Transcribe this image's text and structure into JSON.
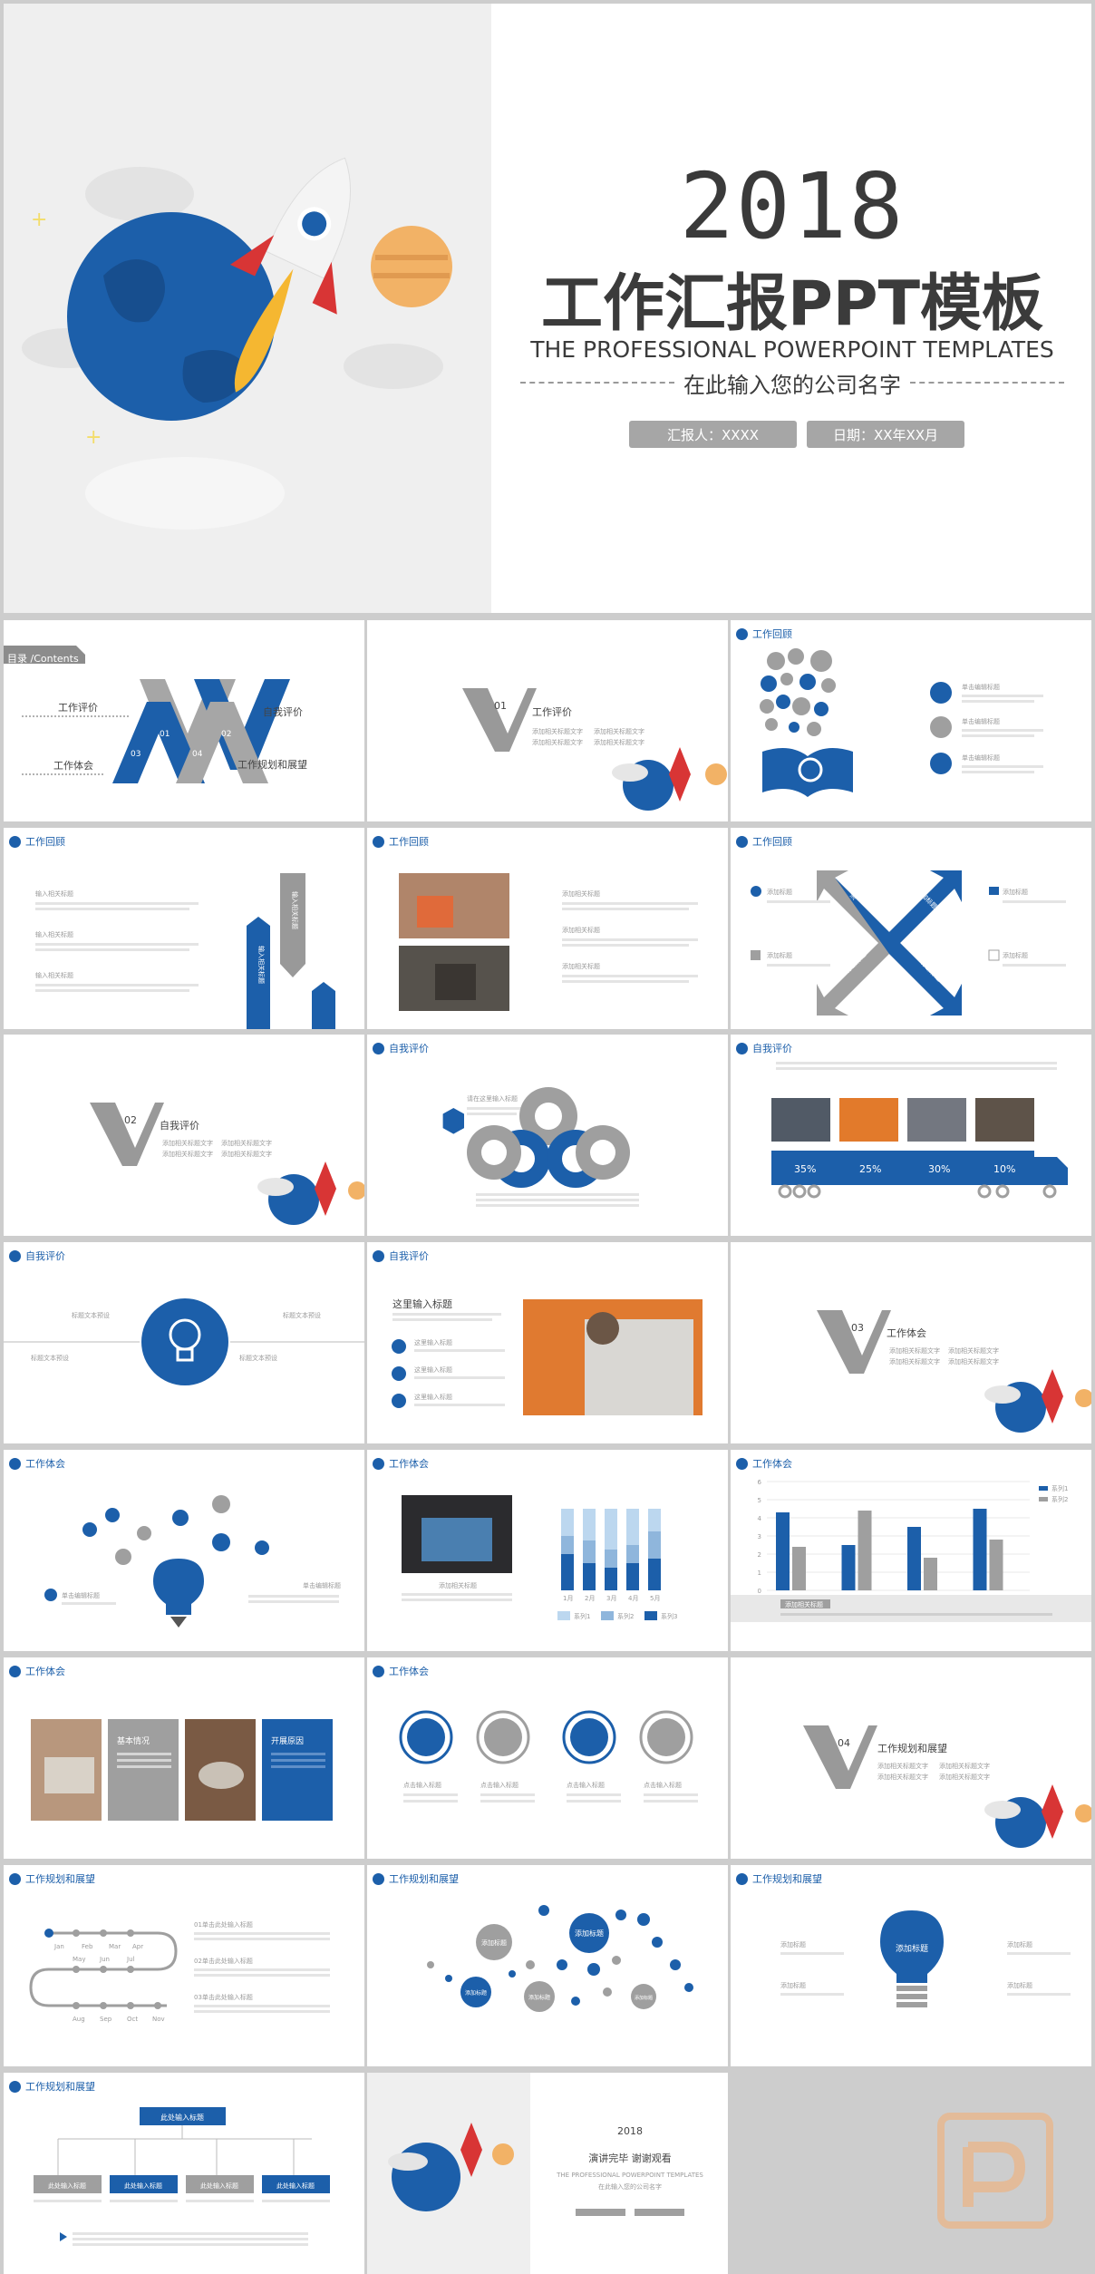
{
  "cover": {
    "year": "2018",
    "title": "工作汇报PPT模板",
    "subtitle_en": "THE PROFESSIONAL POWERPOINT TEMPLATES",
    "company": "在此输入您的公司名字",
    "reporter": "汇报人：XXXX",
    "date": "日期：XX年XX月"
  },
  "toc": {
    "tag": "目录 /Contents",
    "items": [
      "工作评价",
      "自我评价",
      "工作体会",
      "工作规划和展望"
    ],
    "nums": [
      "01",
      "02",
      "03",
      "04"
    ]
  },
  "sections": [
    {
      "num": "01",
      "title": "工作评价",
      "bullets": [
        "添加相关标题文字",
        "添加相关标题文字",
        "添加相关标题文字",
        "添加相关标题文字"
      ]
    },
    {
      "num": "02",
      "title": "自我评价",
      "bullets": [
        "添加相关标题文字",
        "添加相关标题文字",
        "添加相关标题文字",
        "添加相关标题文字"
      ]
    },
    {
      "num": "03",
      "title": "工作体会",
      "bullets": [
        "添加相关标题文字",
        "添加相关标题文字",
        "添加相关标题文字",
        "添加相关标题文字"
      ]
    },
    {
      "num": "04",
      "title": "工作规划和展望",
      "bullets": [
        "添加相关标题文字",
        "添加相关标题文字",
        "添加相关标题文字",
        "添加相关标题文字"
      ]
    }
  ],
  "headers": {
    "review": "工作回顾",
    "self": "自我评价",
    "exp": "工作体会",
    "plan": "工作规划和展望"
  },
  "slide3": {
    "items": [
      "单击编辑标题",
      "单击编辑标题",
      "单击编辑标题"
    ]
  },
  "slide4": {
    "items": [
      "输入相关标题",
      "输入相关标题",
      "输入相关标题"
    ],
    "bars": [
      "输入相关标题",
      "输入相关标题"
    ]
  },
  "slide5": {
    "items": [
      "添加相关标题",
      "添加相关标题",
      "添加相关标题"
    ]
  },
  "slide6": {
    "items": [
      "添加标题",
      "添加标题",
      "添加标题",
      "添加标题"
    ],
    "arrows": [
      "添加标题",
      "添加标题",
      "添加标题",
      "添加标题"
    ]
  },
  "slide8": {
    "title": "请在这里输入标题"
  },
  "slide9": {
    "percents": [
      "35%",
      "25%",
      "30%",
      "10%"
    ]
  },
  "slide10": {
    "labels": [
      "标题文本预设",
      "标题文本预设",
      "标题文本预设",
      "标题文本预设"
    ]
  },
  "slide11": {
    "title": "这里输入标题",
    "items": [
      "这里输入标题",
      "这里输入标题",
      "这里输入标题"
    ]
  },
  "slide13": {
    "title": "单击编辑标题",
    "small": "单击编辑标题"
  },
  "slide14": {
    "caption": "添加相关标题",
    "bars": [
      [
        60,
        40
      ],
      [
        55,
        30
      ],
      [
        45,
        25
      ],
      [
        50,
        30
      ],
      [
        65,
        35
      ]
    ],
    "xlabels": [
      "1月",
      "2月",
      "3月",
      "4月",
      "5月"
    ],
    "legend": [
      "系列1",
      "系列2",
      "系列3"
    ]
  },
  "slide15": {
    "series": [
      {
        "name": "系列1",
        "values": [
          4.3,
          2.5,
          3.5,
          4.5
        ]
      },
      {
        "name": "系列2",
        "values": [
          2.4,
          4.4,
          1.8,
          2.8
        ]
      }
    ],
    "ylim": [
      0,
      6
    ],
    "yticks": [
      "0",
      "1",
      "2",
      "3",
      "4",
      "5",
      "6"
    ],
    "box": "添加相关标题"
  },
  "slide16": {
    "a": "基本情况",
    "b": "开展原因"
  },
  "slide17": {
    "items": [
      "点击输入标题",
      "点击输入标题",
      "点击输入标题",
      "点击输入标题"
    ]
  },
  "slide19": {
    "months": [
      "Jan",
      "Feb",
      "Mar",
      "Apr",
      "May",
      "Jun",
      "Jul",
      "Aug",
      "Sep",
      "Oct",
      "Nov"
    ],
    "items": [
      "01单击此处输入标题",
      "02单击此处输入标题",
      "03单击此处输入标题"
    ]
  },
  "slide20": {
    "bubbles": [
      "添加标题",
      "添加标题",
      "添加标题",
      "添加标题",
      "添加标题"
    ]
  },
  "slide21": {
    "center": "添加标题",
    "items": [
      "添加标题",
      "添加标题",
      "添加标题",
      "添加标题"
    ]
  },
  "slide22": {
    "top": "此处输入标题",
    "items": [
      "此处输入标题",
      "此处输入标题",
      "此处输入标题",
      "此处输入标题"
    ]
  },
  "ending": {
    "year": "2018",
    "title": "演讲完毕 谢谢观看",
    "en": "THE PROFESSIONAL POWERPOINT TEMPLATES",
    "company": "在此输入您的公司名字"
  },
  "colors": {
    "blue": "#1c5faa",
    "grey": "#a0a0a0",
    "light": "#efefef"
  }
}
